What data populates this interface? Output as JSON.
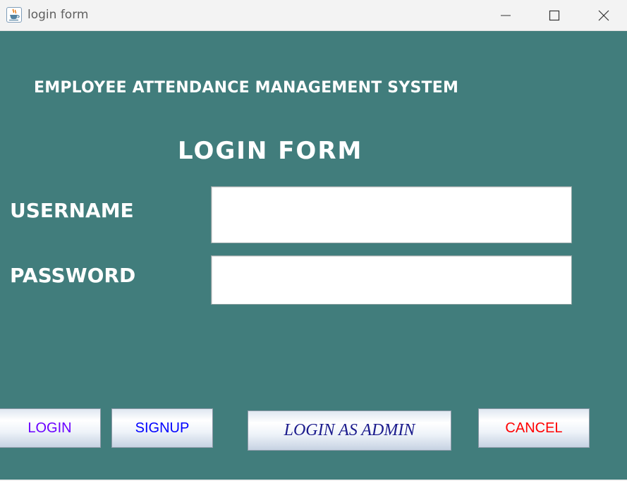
{
  "window": {
    "title": "login form",
    "icons": {
      "app": "java-cup-icon",
      "minimize": "minimize-icon",
      "maximize": "maximize-icon",
      "close": "close-icon"
    }
  },
  "header": {
    "system_title": "EMPLOYEE ATTENDANCE MANAGEMENT SYSTEM",
    "form_title": "LOGIN FORM"
  },
  "form": {
    "username_label": "USERNAME",
    "password_label": "PASSWORD",
    "username_value": "",
    "password_value": ""
  },
  "buttons": {
    "login": "LOGIN",
    "signup": "SIGNUP",
    "login_admin": "LOGIN AS ADMIN",
    "cancel": "CANCEL"
  },
  "colors": {
    "background": "#417d7c",
    "login_text": "#6a00ff",
    "signup_text": "#0000ff",
    "admin_text": "#1a1a8c",
    "cancel_text": "#ff0000"
  }
}
